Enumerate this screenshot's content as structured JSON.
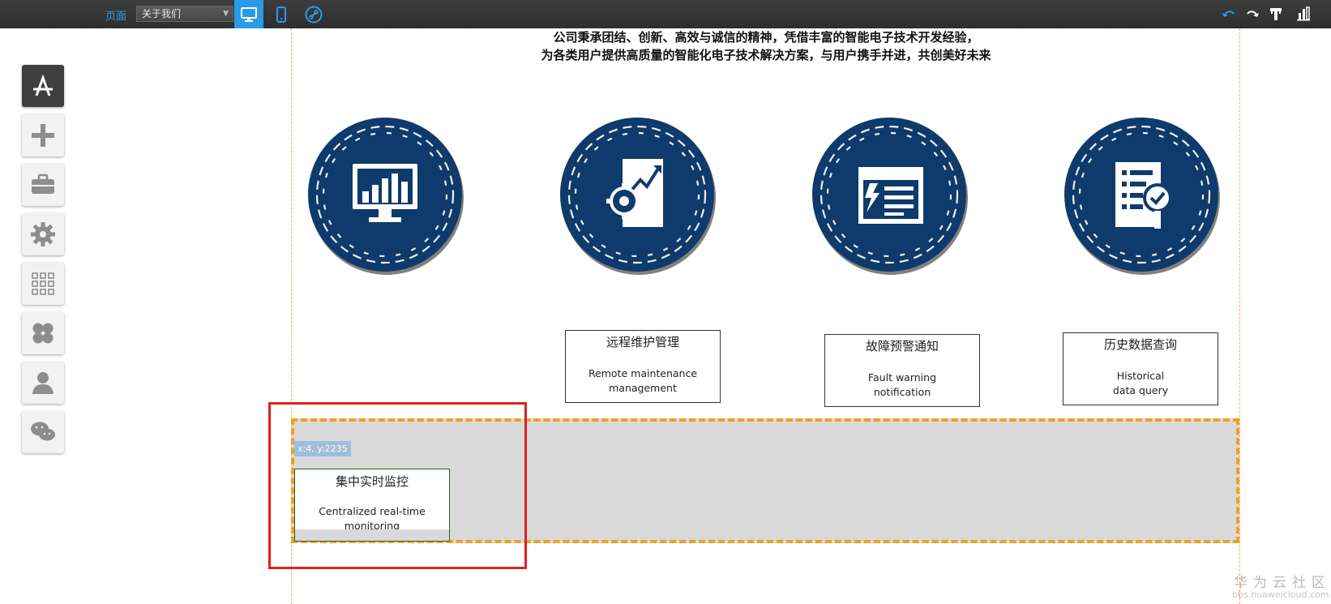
{
  "toolbar": {
    "page_label": "页面",
    "page_select_value": "关于我们"
  },
  "intro": {
    "line1": "公司秉承团结、创新、高效与诚信的精神，凭借丰富的智能电子技术开发经验，",
    "line2": "为各类用户提供高质量的智能化电子技术解决方案，与用户携手并进，共创美好未来"
  },
  "features": [
    {
      "icon": "monitor-chart-icon"
    },
    {
      "icon": "gear-growth-icon",
      "title": "远程维护管理",
      "subtitle_line1": "Remote maintenance",
      "subtitle_line2": "management"
    },
    {
      "icon": "alert-document-icon",
      "title": "故障预警通知",
      "subtitle_line1": "Fault warning",
      "subtitle_line2": "notification"
    },
    {
      "icon": "document-search-icon",
      "title": "历史数据查询",
      "subtitle_line1": "Historical",
      "subtitle_line2": "data query"
    }
  ],
  "selected": {
    "coord_tip": "x:4, y:2235",
    "title": "集中实时监控",
    "subtitle_line1": "Centralized real-time",
    "subtitle_line2": "monitoring"
  },
  "watermark": {
    "zh": "华为云社区",
    "en": "bbs.huaweicloud.com"
  },
  "colors": {
    "accent": "#2b9be8",
    "circle": "#0e3b6b",
    "section_border": "#f0a21e",
    "section_fill": "#d9d9d9",
    "highlight": "#e02020"
  }
}
